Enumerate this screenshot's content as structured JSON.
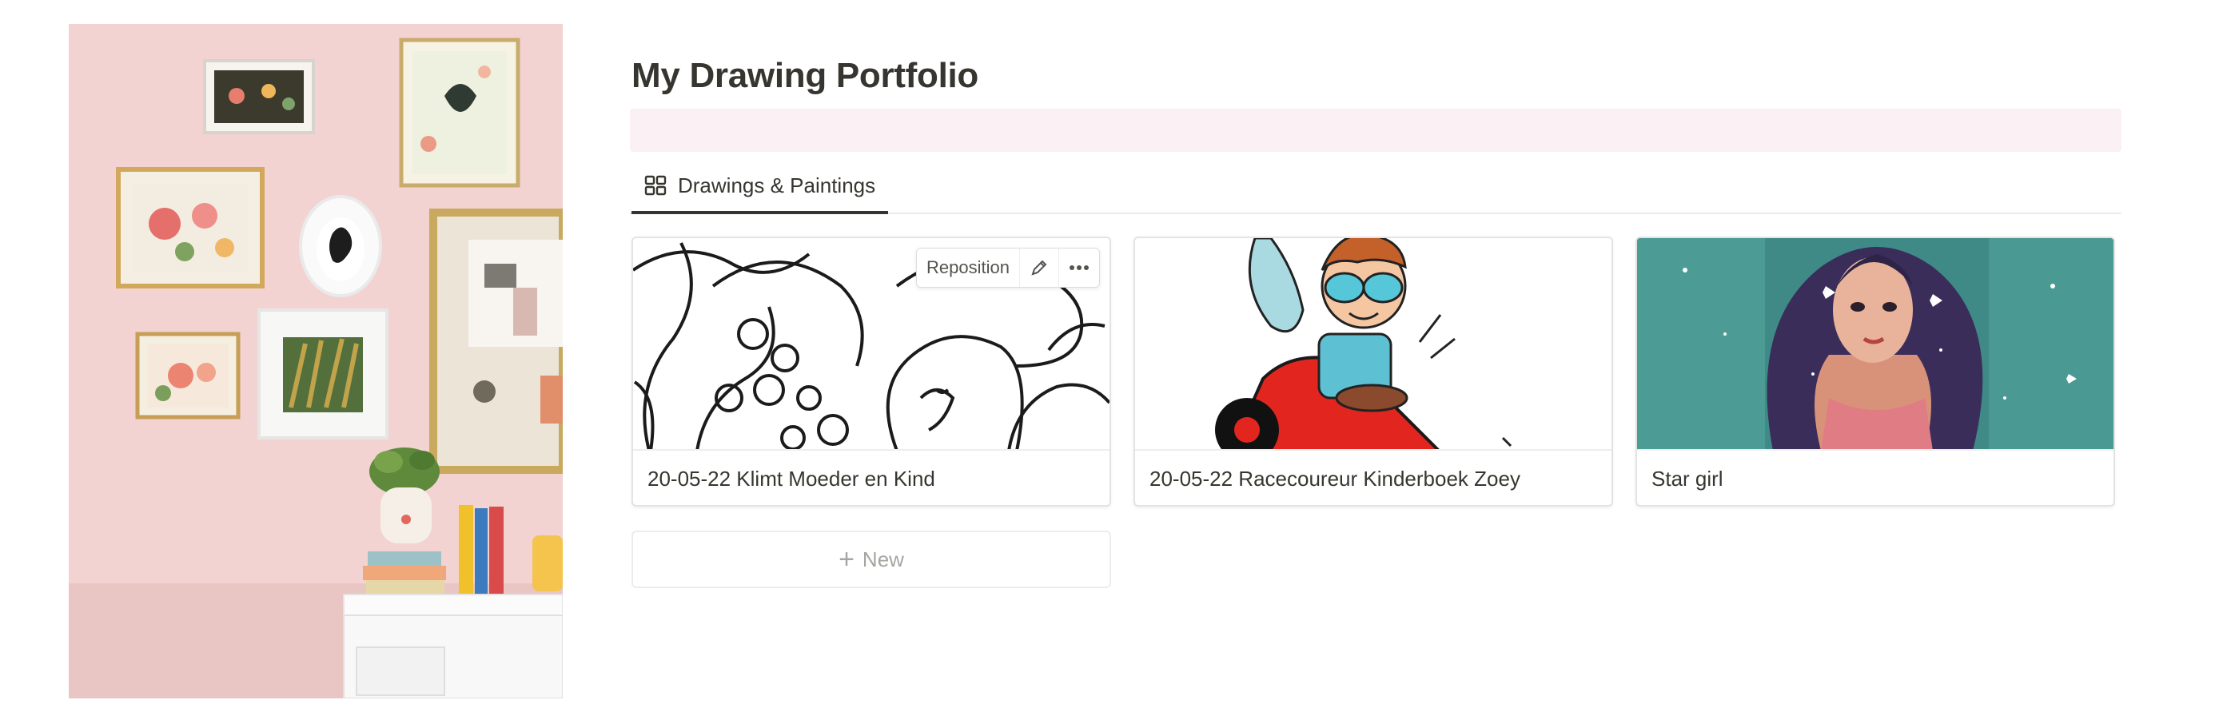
{
  "page": {
    "title": "My Drawing Portfolio"
  },
  "colors": {
    "banner": "#fbf0f3",
    "text": "#37352f",
    "muted": "#a6a5a1",
    "cover_wall": "#f1cfcf"
  },
  "view_tabs": [
    {
      "label": "Drawings & Paintings",
      "icon": "gallery-grid-icon",
      "active": true
    }
  ],
  "gallery": {
    "cards": [
      {
        "title": "20-05-22 Klimt Moeder en Kind",
        "image": "line-drawing"
      },
      {
        "title": "20-05-22 Racecoureur Kinderboek Zoey",
        "image": "cartoon-race-car"
      },
      {
        "title": "Star girl",
        "image": "watercolor-portrait"
      }
    ],
    "card_toolbar": {
      "reposition_label": "Reposition",
      "edit_icon": "pencil-icon",
      "more_icon": "more-horizontal-icon"
    },
    "new_button": {
      "label": "New",
      "icon": "plus-icon"
    }
  }
}
